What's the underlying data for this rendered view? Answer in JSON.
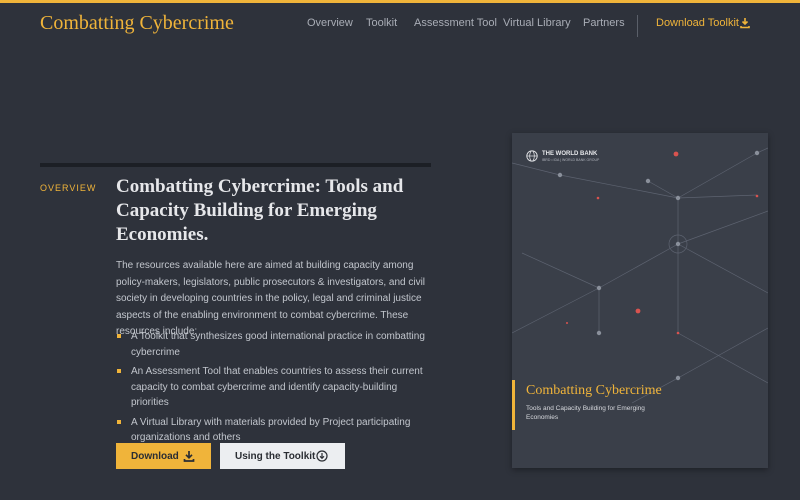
{
  "header": {
    "site_title": "Combatting Cybercrime",
    "nav": [
      {
        "label": "Overview"
      },
      {
        "label": "Toolkit"
      },
      {
        "label": "Assessment Tool"
      },
      {
        "label": "Virtual Library"
      },
      {
        "label": "Partners"
      }
    ],
    "download_toolkit": "Download Toolkit"
  },
  "main": {
    "section_label": "OVERVIEW",
    "title": "Combatting Cybercrime: Tools and Capacity Building for Emerging Economies.",
    "intro": "The resources available here are aimed at building capacity among policy-makers, legislators, public prosecutors & investigators, and civil society in developing countries in the policy, legal and criminal justice aspects of the enabling environment to combat cybercrime. These resources include:",
    "bullets": [
      "A Toolkit that synthesizes good international practice in combatting cybercrime",
      "An Assessment Tool that enables countries to assess their current capacity to combat cybercrime and identify capacity-building priorities",
      "A Virtual Library with materials provided by Project participating organizations and others"
    ],
    "buttons": {
      "download": "Download",
      "using_toolkit": "Using the Toolkit"
    }
  },
  "cover": {
    "publisher": "THE WORLD BANK",
    "publisher_sub": "IBRD • IDA | WORLD BANK GROUP",
    "title": "Combatting Cybercrime",
    "subtitle": "Tools and Capacity Building for Emerging Economies"
  },
  "colors": {
    "accent": "#f0b43a",
    "background": "#2e323b",
    "cover_background": "#3a3f49"
  },
  "icons": [
    "download-icon",
    "arrow-circle-down-icon",
    "globe-icon"
  ]
}
